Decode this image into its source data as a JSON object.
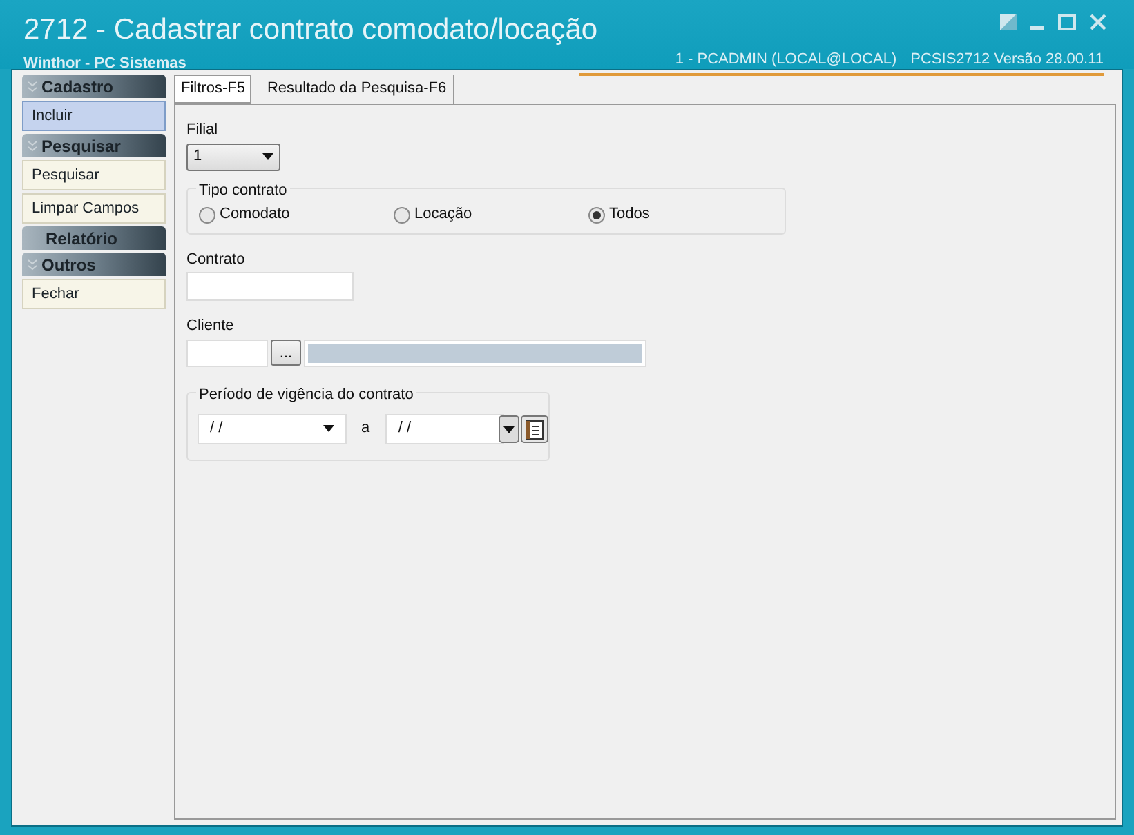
{
  "window": {
    "title": "2712 - Cadastrar contrato comodato/locação",
    "subtitle": "Winthor - PC Sistemas",
    "user_info": "1 - PCADMIN (LOCAL@LOCAL)",
    "version_info": "PCSIS2712  Versão 28.00.11"
  },
  "sidebar": [
    {
      "title": "Cadastro",
      "expanded": true,
      "items": [
        {
          "label": "Incluir",
          "selected": true
        }
      ]
    },
    {
      "title": "Pesquisar",
      "expanded": true,
      "items": [
        {
          "label": "Pesquisar",
          "selected": false
        },
        {
          "label": "Limpar Campos",
          "selected": false
        }
      ]
    },
    {
      "title": "Relatório",
      "expanded": false
    },
    {
      "title": "Outros",
      "expanded": true,
      "items": [
        {
          "label": "Fechar",
          "selected": false
        }
      ]
    }
  ],
  "tabs": [
    {
      "label": "Filtros-F5",
      "selected": true
    },
    {
      "label": "Resultado da Pesquisa-F6",
      "selected": false
    }
  ],
  "form": {
    "filial": {
      "label": "Filial",
      "value": "1"
    },
    "tipo_contrato": {
      "label": "Tipo contrato",
      "options": [
        {
          "label": "Comodato",
          "selected": false
        },
        {
          "label": "Locação",
          "selected": false
        },
        {
          "label": "Todos",
          "selected": true
        }
      ]
    },
    "contrato": {
      "label": "Contrato"
    },
    "cliente": {
      "label": "Cliente",
      "button": "..."
    },
    "periodo": {
      "label": "Período de vigência do contrato",
      "from": "/ /",
      "separator": "a",
      "to": "/ /"
    }
  }
}
